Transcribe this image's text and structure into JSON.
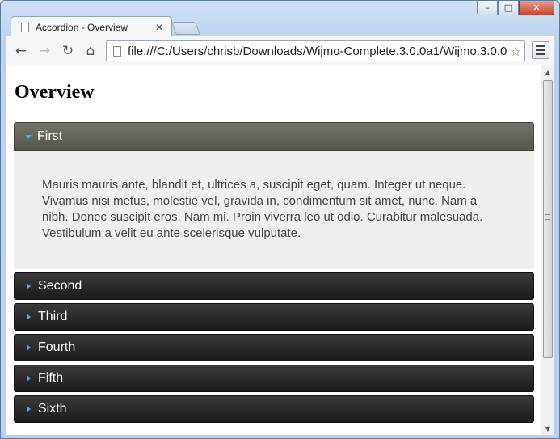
{
  "browser": {
    "tab": {
      "title": "Accordion - Overview",
      "close": "✕"
    },
    "nav": {
      "back": "←",
      "forward": "→",
      "reload": "↻",
      "home": "⌂"
    },
    "url": "file:///C:/Users/chrisb/Downloads/Wijmo-Complete.3.0.0a1/Wijmo.3.0.0",
    "star": "☆",
    "window_controls": {
      "minimize": "–",
      "maximize": "□",
      "close": "✕"
    },
    "icons": [
      "page-icon",
      "back-icon",
      "forward-icon",
      "reload-icon",
      "home-icon",
      "star-icon",
      "menu-icon"
    ]
  },
  "page": {
    "title": "Overview",
    "accordion": {
      "active_index": 0,
      "arrow_color": "#33b5e5",
      "panel_text": "Mauris mauris ante, blandit et, ultrices a, suscipit eget, quam. Integer ut neque. Vivamus nisi metus, molestie vel, gravida in, condimentum sit amet, nunc. Nam a nibh. Donec suscipit eros. Nam mi. Proin viverra leo ut odio. Curabitur malesuada. Vestibulum a velit eu ante scelerisque vulputate.",
      "sections": [
        "First",
        "Second",
        "Third",
        "Fourth",
        "Fifth",
        "Sixth"
      ]
    }
  },
  "scrollbar": {
    "up": "▲",
    "down": "▼"
  }
}
